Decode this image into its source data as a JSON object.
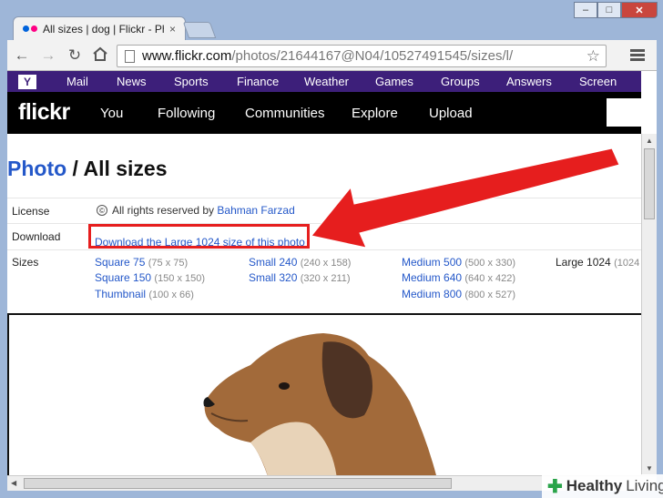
{
  "browser": {
    "tab_title": "All sizes | dog | Flickr - Pho",
    "tab_close": "×",
    "url_host": "www.flickr.com",
    "url_path": "/photos/21644167@N04/10527491545/sizes/l/",
    "back": "←",
    "forward": "→",
    "reload": "↻",
    "star": "☆",
    "min": "–",
    "max": "□",
    "close": "✕"
  },
  "yahoo_bar": {
    "logo": "Y",
    "links": [
      "Mail",
      "News",
      "Sports",
      "Finance",
      "Weather",
      "Games",
      "Groups",
      "Answers",
      "Screen"
    ]
  },
  "flickr": {
    "logo": "flickr",
    "nav": [
      "You",
      "Following",
      "Communities",
      "Explore",
      "Upload"
    ]
  },
  "page": {
    "title_link": "Photo",
    "title_rest": " / All sizes",
    "license_label": "License",
    "license_text": "All rights reserved by",
    "license_owner": "Bahman Farzad",
    "license_icon": "©",
    "download_label": "Download",
    "download_link": "Download the Large 1024 size of this photo",
    "sizes_label": "Sizes",
    "sizes": [
      {
        "name": "Square 75",
        "dim": "(75 x 75)"
      },
      {
        "name": "Square 150",
        "dim": "(150 x 150)"
      },
      {
        "name": "Thumbnail",
        "dim": "(100 x 66)"
      },
      {
        "name": "Small 240",
        "dim": "(240 x 158)"
      },
      {
        "name": "Small 320",
        "dim": "(320 x 211)"
      },
      {
        "name": "Medium 500",
        "dim": "(500 x 330)"
      },
      {
        "name": "Medium 640",
        "dim": "(640 x 422)"
      },
      {
        "name": "Medium 800",
        "dim": "(800 x 527)"
      },
      {
        "name": "Large 1024",
        "dim": "(1024"
      }
    ]
  },
  "watermark": {
    "icon": "✚",
    "word1": "Healthy",
    "word2": "Living"
  },
  "colors": {
    "highlight": "#e61e1e",
    "link": "#2458c9",
    "yahoo_bar": "#3d1f7a"
  }
}
